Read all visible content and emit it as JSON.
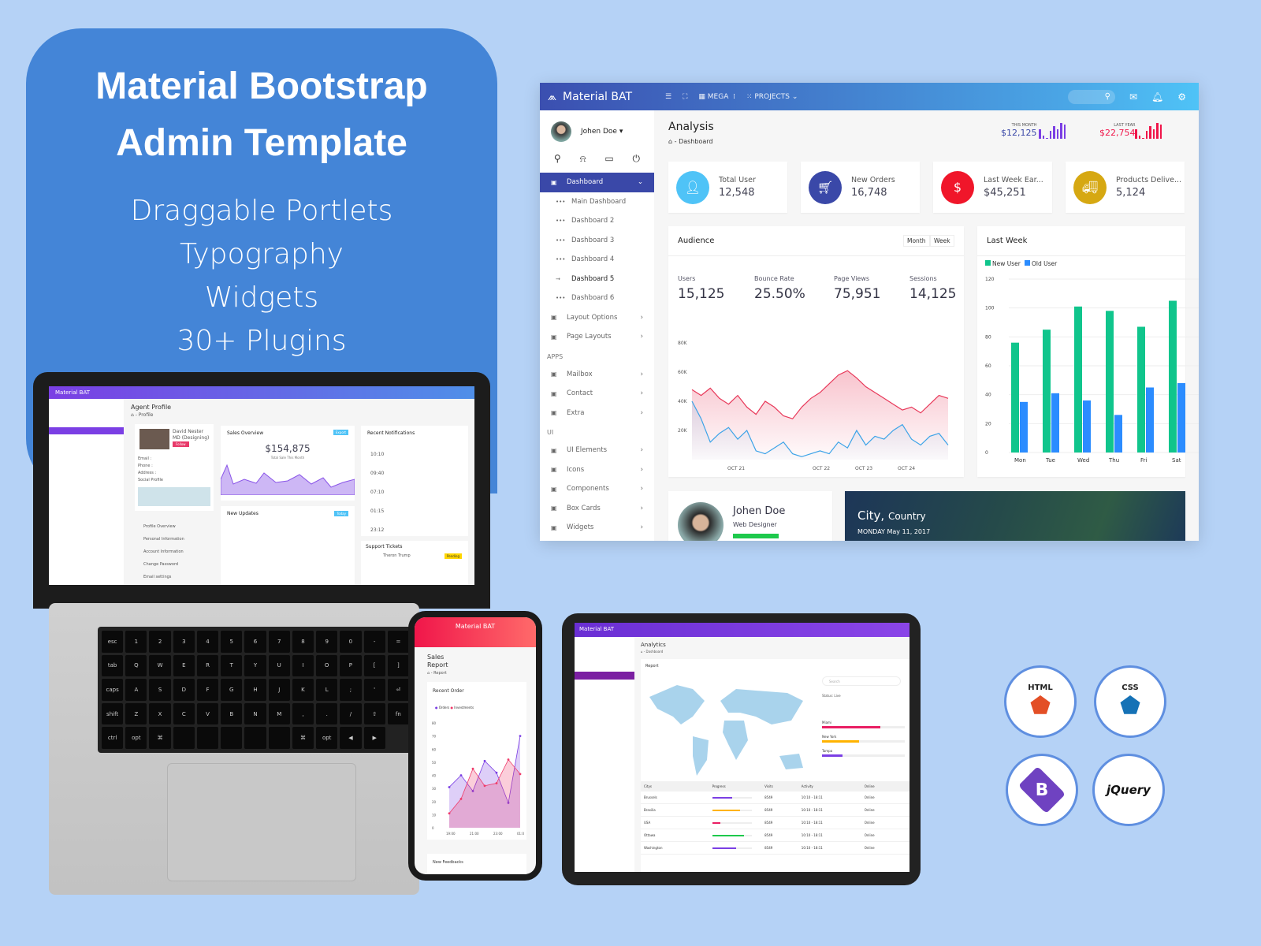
{
  "promo": {
    "title_line1": "Material Bootstrap",
    "title_line2": "Admin Template",
    "features": [
      "Draggable Portlets",
      "Typography",
      "Widgets",
      "30+ Plugins"
    ]
  },
  "colors": {
    "background": "#b5d2f6",
    "promo": "#4485d7",
    "indigo": "#3a48a8",
    "purple": "#7b3fe4",
    "red": "#f0164a",
    "green": "#10c58c",
    "blue": "#2b8cff",
    "yellow": "#d6a812",
    "cyan": "#4fc3f7"
  },
  "dash": {
    "brand": "Material BAT",
    "nav": [
      "MEGA",
      "PROJECTS"
    ],
    "user": "Johen Doe",
    "sidebar": [
      {
        "label": "Dashboard",
        "type": "active",
        "icon": "monitor-icon"
      },
      {
        "label": "Main Dashboard",
        "type": "sub"
      },
      {
        "label": "Dashboard 2",
        "type": "sub"
      },
      {
        "label": "Dashboard 3",
        "type": "sub"
      },
      {
        "label": "Dashboard 4",
        "type": "sub"
      },
      {
        "label": "Dashboard 5",
        "type": "sub-current"
      },
      {
        "label": "Dashboard 6",
        "type": "sub"
      },
      {
        "label": "Layout Options",
        "type": "item",
        "icon": "layout-icon"
      },
      {
        "label": "Page Layouts",
        "type": "item",
        "icon": "pages-icon"
      },
      {
        "label": "APPS",
        "type": "section"
      },
      {
        "label": "Mailbox",
        "type": "item",
        "icon": "mail-icon"
      },
      {
        "label": "Contact",
        "type": "item",
        "icon": "contact-icon"
      },
      {
        "label": "Extra",
        "type": "item",
        "icon": "copy-icon"
      },
      {
        "label": "UI",
        "type": "section"
      },
      {
        "label": "UI Elements",
        "type": "item",
        "icon": "crop-icon"
      },
      {
        "label": "Icons",
        "type": "item",
        "icon": "icons-icon"
      },
      {
        "label": "Components",
        "type": "item",
        "icon": "grid-icon"
      },
      {
        "label": "Box Cards",
        "type": "item",
        "icon": "gear-icon"
      },
      {
        "label": "Widgets",
        "type": "item",
        "icon": "widget-icon"
      }
    ],
    "title": "Analysis",
    "breadcrumb": "Dashboard",
    "this_month": {
      "label": "THIS MONTH",
      "value": "$12,125"
    },
    "last_year": {
      "label": "LAST YEAR",
      "value": "$22,754"
    },
    "stats": [
      {
        "label": "Total User",
        "value": "12,548",
        "color": "#4fc3f7",
        "icon": "user-icon"
      },
      {
        "label": "New Orders",
        "value": "16,748",
        "color": "#3a48a8",
        "icon": "cart-icon"
      },
      {
        "label": "Last Week Ear...",
        "value": "$45,251",
        "color": "#f0162a",
        "icon": "money-icon"
      },
      {
        "label": "Products Delive...",
        "value": "5,124",
        "color": "#d6a812",
        "icon": "truck-icon"
      }
    ],
    "audience": {
      "title": "Audience",
      "tabs": [
        "Month",
        "Week"
      ],
      "metrics": [
        {
          "label": "Users",
          "value": "15,125"
        },
        {
          "label": "Bounce Rate",
          "value": "25.50%"
        },
        {
          "label": "Page Views",
          "value": "75,951"
        },
        {
          "label": "Sessions",
          "value": "14,125"
        }
      ]
    },
    "profile": {
      "name": "Johen Doe",
      "role": "Web Designer"
    },
    "weather": {
      "city": "City,",
      "country": "Country",
      "date": "MONDAY May 11, 2017"
    }
  },
  "chart_data": [
    {
      "type": "area",
      "ylabel": "",
      "y_ticks": [
        "80K",
        "60K",
        "40K",
        "20K"
      ],
      "ylim": [
        0,
        80000
      ],
      "x_ticks": [
        "OCT 21",
        "OCT 22",
        "OCT 23",
        "OCT 24"
      ],
      "series": [
        {
          "color": "#e8395a",
          "values": [
            48000,
            44000,
            49000,
            42000,
            38000,
            44000,
            36000,
            31000,
            40000,
            36000,
            30000,
            28000,
            36000,
            42000,
            46000,
            52000,
            58000,
            61000,
            56000,
            50000,
            46000,
            42000,
            38000,
            34000,
            36000,
            32000,
            38000,
            44000,
            42000
          ]
        },
        {
          "color": "#3ba3e8",
          "values": [
            40000,
            28000,
            12000,
            18000,
            22000,
            14000,
            20000,
            6000,
            4000,
            8000,
            12000,
            4000,
            2000,
            4000,
            6000,
            4000,
            12000,
            8000,
            20000,
            10000,
            16000,
            14000,
            20000,
            24000,
            14000,
            10000,
            16000,
            18000,
            10000
          ]
        }
      ]
    },
    {
      "type": "bar",
      "title": "Last Week",
      "categories": [
        "Mon",
        "Tue",
        "Wed",
        "Thu",
        "Fri",
        "Sat"
      ],
      "ylim": [
        0,
        120
      ],
      "y_ticks": [
        0,
        20,
        40,
        60,
        80,
        100,
        120
      ],
      "legend": "top-left",
      "series": [
        {
          "name": "New User",
          "color": "#10c58c",
          "values": [
            76,
            85,
            101,
            98,
            87,
            105
          ]
        },
        {
          "name": "Old User",
          "color": "#2b8cff",
          "values": [
            35,
            41,
            36,
            26,
            45,
            48
          ]
        }
      ]
    },
    {
      "type": "area",
      "title": "Recent Order",
      "x_ticks": [
        "19:00",
        "21:00",
        "23:00",
        "01:0"
      ],
      "ylim": [
        0,
        80
      ],
      "y_ticks": [
        0,
        10,
        20,
        30,
        40,
        50,
        60,
        70,
        80
      ],
      "series": [
        {
          "name": "Orders",
          "color": "#7b3fe4",
          "values": [
            31,
            40,
            28,
            51,
            42,
            19,
            70
          ]
        },
        {
          "name": "Investments",
          "color": "#ef3b6a",
          "values": [
            11,
            22,
            45,
            32,
            34,
            52,
            41
          ]
        }
      ]
    }
  ],
  "laptop": {
    "brand": "Material BAT",
    "title": "Agent Profile",
    "breadcrumb": "Profile",
    "agent": "David Nester",
    "role": "MD (Designing)",
    "follow": "Follow",
    "fields": [
      "Email :",
      "Phone :",
      "Address :",
      "Social Profile"
    ],
    "sales_title": "Sales Overview",
    "export": "Export",
    "sales_value": "$154,875",
    "sales_sub": "Total Sale This Month",
    "notif_title": "Recent Notifications",
    "notif_times": [
      "10:10",
      "09:40",
      "07:10",
      "01:15",
      "23:12"
    ],
    "updates_title": "New Updates",
    "today": "Today",
    "tickets_title": "Support Tickets",
    "ticket_user": "Theron Trump",
    "pending": "Pending",
    "menu": [
      "Profile Overview",
      "Personal Information",
      "Account Information",
      "Change Password",
      "Email settings"
    ]
  },
  "phone": {
    "brand": "Material BAT",
    "title_line1": "Sales",
    "title_line2": "Report",
    "breadcrumb": "Report",
    "card": "Recent Order",
    "legend": [
      "Orders",
      "Investments"
    ],
    "next_card": "New Feedbacks"
  },
  "tablet": {
    "brand": "Material BAT",
    "title": "Analytics",
    "breadcrumb": "Dashboard",
    "card": "Report",
    "search_placeholder": "Search",
    "status": "Status: Live",
    "cities": [
      {
        "name": "Miami",
        "pct": 70,
        "color": "#e91e63"
      },
      {
        "name": "New York",
        "pct": 45,
        "color": "#ffb300"
      },
      {
        "name": "Tampa",
        "pct": 25,
        "color": "#7b3fe4"
      }
    ],
    "table_headers": [
      "Citys",
      "Progress",
      "Visits",
      "Activity",
      "Online"
    ],
    "rows": [
      {
        "city": "Brussels",
        "pct": 50,
        "color": "#7b3fe4"
      },
      {
        "city": "Brasilia",
        "pct": 70,
        "color": "#ffb300"
      },
      {
        "city": "USA",
        "pct": 20,
        "color": "#e91e63"
      },
      {
        "city": "Ottawa",
        "pct": 80,
        "color": "#1ec94c"
      },
      {
        "city": "Washington",
        "pct": 60,
        "color": "#7b3fe4"
      }
    ],
    "visits": "8549",
    "activity": "10:10 - 18:11",
    "online": "Online"
  },
  "logos": [
    "HTML",
    "CSS",
    "B",
    "jQuery"
  ]
}
